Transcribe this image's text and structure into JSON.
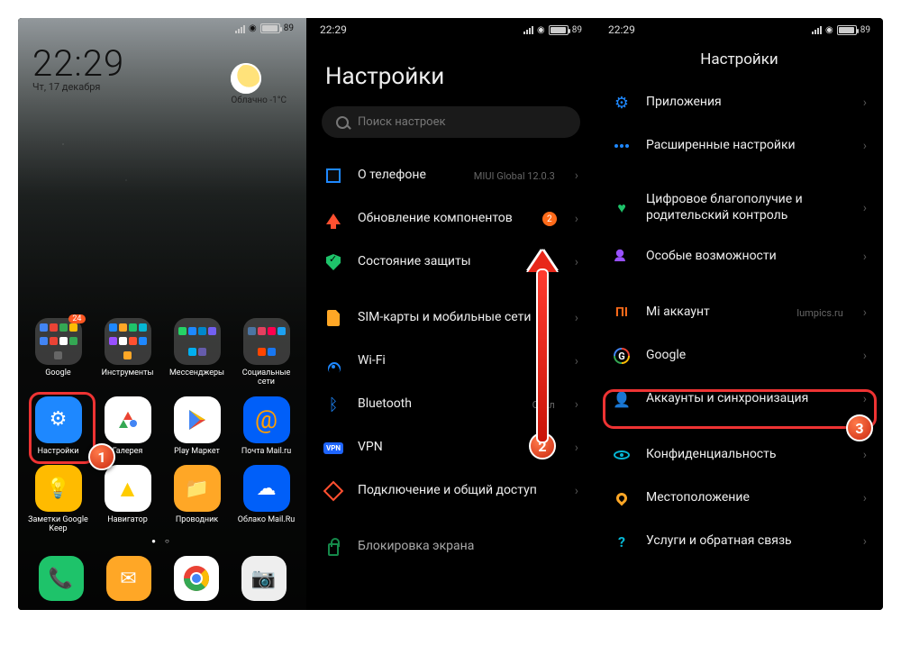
{
  "status": {
    "time": "22:29",
    "battery_pct": "89"
  },
  "home": {
    "clock_time": "22:29",
    "clock_date": "Чт, 17 декабря",
    "weather_text": "Облачно -1°C",
    "folders": [
      {
        "label": "Google",
        "badge": "24"
      },
      {
        "label": "Инструменты"
      },
      {
        "label": "Мессенджеры"
      },
      {
        "label": "Социальные сети"
      }
    ],
    "apps_row2": [
      {
        "label": "Настройки"
      },
      {
        "label": "Галерея"
      },
      {
        "label": "Play Маркет"
      },
      {
        "label": "Почта Mail.ru"
      }
    ],
    "apps_row3": [
      {
        "label": "Заметки Google Keep"
      },
      {
        "label": "Навигатор"
      },
      {
        "label": "Проводник"
      },
      {
        "label": "Облако Mail.Ru"
      }
    ]
  },
  "settings": {
    "title": "Настройки",
    "search_placeholder": "Поиск настроек",
    "rows": {
      "about": {
        "label": "О телефоне",
        "meta": "MIUI Global 12.0.3"
      },
      "updates": {
        "label": "Обновление компонентов",
        "badge": "2"
      },
      "security": {
        "label": "Состояние защиты"
      },
      "sim": {
        "label": "SIM-карты и мобильные сети"
      },
      "wifi": {
        "label": "Wi-Fi"
      },
      "bt": {
        "label": "Bluetooth",
        "meta": "Откл"
      },
      "vpn": {
        "label": "VPN"
      },
      "share": {
        "label": "Подключение и общий доступ"
      },
      "lock": {
        "label": "Блокировка экрана"
      }
    }
  },
  "settings2": {
    "title": "Настройки",
    "rows": {
      "apps": {
        "label": "Приложения"
      },
      "adv": {
        "label": "Расширенные настройки"
      },
      "wellbeing": {
        "label": "Цифровое благополучие и родительский контроль"
      },
      "access": {
        "label": "Особые возможности"
      },
      "mi": {
        "label": "Mi аккаунт",
        "meta": "lumpics.ru"
      },
      "google": {
        "label": "Google"
      },
      "accounts": {
        "label": "Аккаунты и синхронизация"
      },
      "privacy": {
        "label": "Конфиденциальность"
      },
      "location": {
        "label": "Местоположение"
      },
      "feedback": {
        "label": "Услуги и обратная связь"
      }
    }
  },
  "markers": {
    "n1": "1",
    "n2": "2",
    "n3": "3"
  }
}
